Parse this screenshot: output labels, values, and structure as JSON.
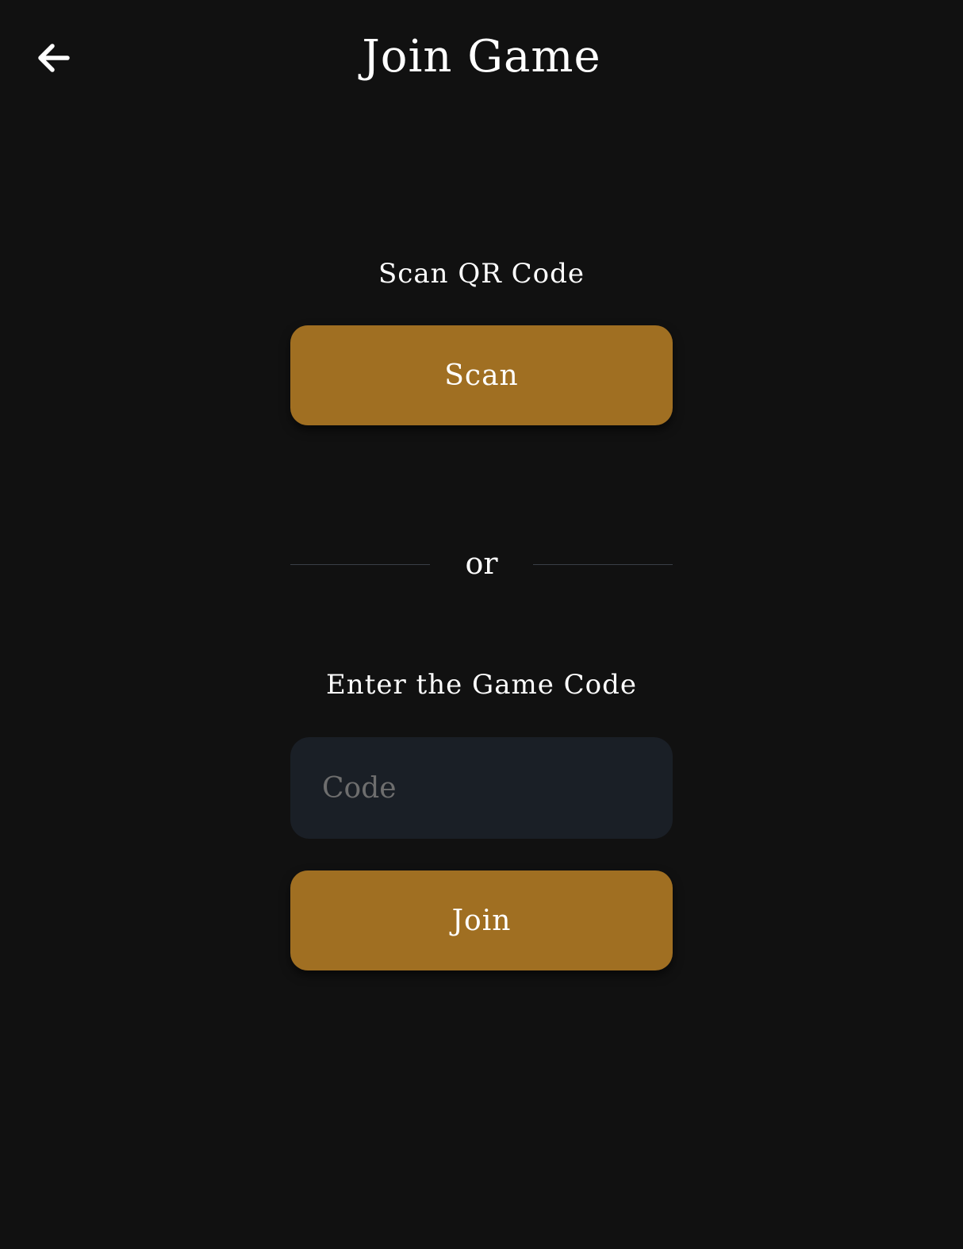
{
  "header": {
    "title": "Join Game",
    "back_icon": "arrow-left-icon"
  },
  "scan": {
    "label": "Scan QR Code",
    "button_label": "Scan"
  },
  "divider": {
    "text": "or"
  },
  "code": {
    "label": "Enter the Game Code",
    "placeholder": "Code",
    "value": "",
    "join_label": "Join"
  },
  "colors": {
    "background": "#111111",
    "accent": "#a06f22",
    "input_background": "#1a1f26",
    "divider": "#3a3f47",
    "placeholder": "#6e6e6e",
    "text": "#ffffff"
  }
}
